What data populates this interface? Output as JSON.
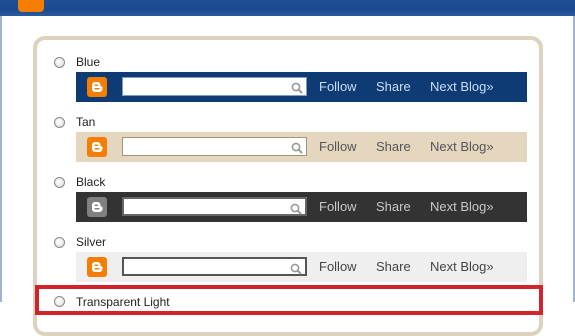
{
  "window": {
    "accent": "#1f4f95",
    "brand": "#f57d00"
  },
  "options": [
    {
      "label": "Blue",
      "bar_bg": "#0f3b74",
      "link_color": "#c9def5",
      "logo_bg": "#f57d00",
      "logo_fg": "#ffffff",
      "search_border": "#7a9cc8"
    },
    {
      "label": "Tan",
      "bar_bg": "#e4d6bf",
      "link_color": "#555555",
      "logo_bg": "#f57d00",
      "logo_fg": "#ffffff",
      "search_border": "#a5947a"
    },
    {
      "label": "Black",
      "bar_bg": "#333333",
      "link_color": "#c8c8c8",
      "logo_bg": "#808080",
      "logo_fg": "#ffffff",
      "search_border": "#666666"
    },
    {
      "label": "Silver",
      "bar_bg": "#efefef",
      "link_color": "#444444",
      "logo_bg": "#f57d00",
      "logo_fg": "#ffffff",
      "search_border": "#555555"
    }
  ],
  "navbar": {
    "follow_label": "Follow",
    "share_label": "Share",
    "next_blog_label": "Next Blog»",
    "search_placeholder": ""
  },
  "selected_option": {
    "label": "Transparent Light",
    "highlight_color": "#d2232a"
  }
}
